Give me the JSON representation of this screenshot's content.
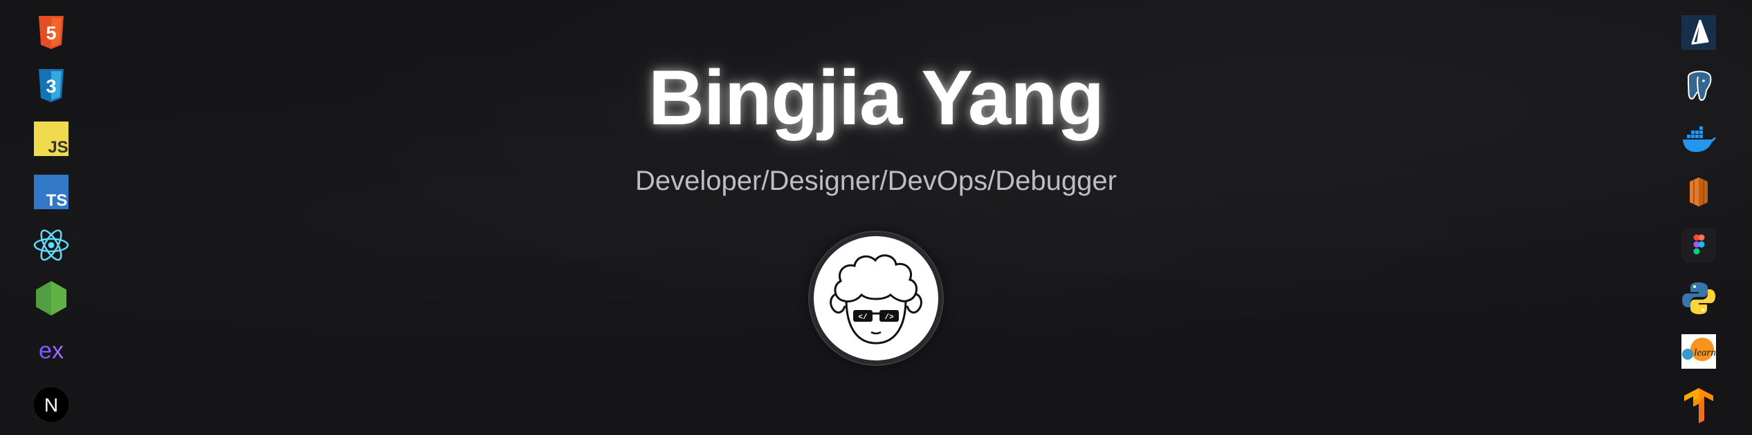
{
  "hero": {
    "name": "Bingjia Yang",
    "subtitle": "Developer/Designer/DevOps/Debugger"
  },
  "avatar": {
    "icon": "sheep-with-sunglasses-avatar",
    "glasses_left": "</",
    "glasses_right": "/>"
  },
  "left_icons": [
    {
      "name": "html5-icon",
      "glyph": "5",
      "color": "#e44d26"
    },
    {
      "name": "css3-icon",
      "glyph": "3",
      "color": "#2965f1"
    },
    {
      "name": "javascript-icon",
      "glyph": "JS",
      "color": "#f0db4f"
    },
    {
      "name": "typescript-icon",
      "glyph": "TS",
      "color": "#3178c6"
    },
    {
      "name": "react-icon",
      "glyph": "",
      "color": "#61dafb"
    },
    {
      "name": "nodejs-icon",
      "glyph": "",
      "color": "#539e43"
    },
    {
      "name": "express-icon",
      "glyph": "ex",
      "color": "#8e6cff"
    },
    {
      "name": "nextjs-icon",
      "glyph": "N",
      "color": "#000000"
    }
  ],
  "right_icons": [
    {
      "name": "prisma-icon",
      "glyph": "",
      "color": "#16304b"
    },
    {
      "name": "postgresql-icon",
      "glyph": "",
      "color": "#336791"
    },
    {
      "name": "docker-icon",
      "glyph": "",
      "color": "#2496ed"
    },
    {
      "name": "aws-icon",
      "glyph": "",
      "color": "#e37b2f"
    },
    {
      "name": "figma-icon",
      "glyph": "",
      "color": "#a259ff"
    },
    {
      "name": "python-icon",
      "glyph": "",
      "color": "#3776ab"
    },
    {
      "name": "scikit-learn-icon",
      "glyph": "learn",
      "color": "#f7931e"
    },
    {
      "name": "tensorflow-icon",
      "glyph": "",
      "color": "#ff8f00"
    }
  ]
}
